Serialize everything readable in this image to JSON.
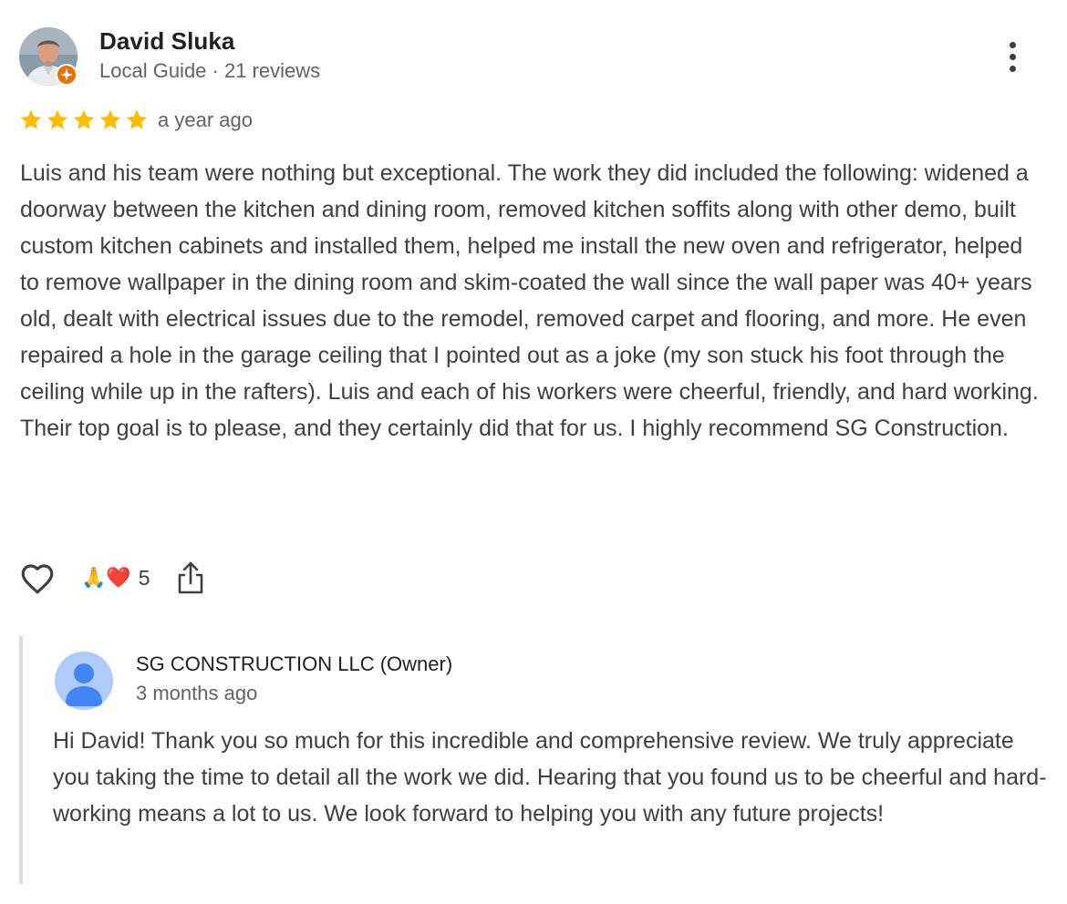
{
  "reviewer": {
    "name": "David Sluka",
    "meta": "Local Guide · 21 reviews",
    "avatar_icon": "reviewer-photo",
    "badge_icon": "local-guide-badge-icon"
  },
  "rating": {
    "stars": 5,
    "max_stars": 5,
    "star_color": "#fbbc04",
    "date": "a year ago"
  },
  "review_text": "Luis and his team were nothing but exceptional. The work they did included the following: widened a doorway between the kitchen and dining room, removed kitchen soffits along with other demo, built custom kitchen cabinets and installed them, helped me install the new oven and refrigerator, helped to remove wallpaper in the dining room and skim-coated the wall since the wall paper was 40+ years old, dealt with electrical issues due to the remodel, removed carpet and flooring, and more. He even repaired a hole in the garage ceiling that I pointed out as a joke (my son stuck his foot through the ceiling while up in the rafters). Luis and each of his workers were cheerful, friendly, and hard working. Their top goal is to please, and they certainly did that for us. I highly recommend SG Construction.",
  "actions": {
    "like_icon": "heart-outline-icon",
    "reactions_emoji": "🙏❤️",
    "reactions_count": "5",
    "share_icon": "share-icon"
  },
  "owner_reply": {
    "author": "SG CONSTRUCTION LLC (Owner)",
    "date": "3 months ago",
    "avatar_icon": "default-person-avatar-icon",
    "text": "Hi David! Thank you so much for this incredible and comprehensive review. We truly appreciate you taking the time to detail all the work we did. Hearing that you found us to be cheerful and hard-working means a lot to us. We look forward to helping you with any future projects!"
  },
  "colors": {
    "text": "#3c4043",
    "secondary": "#5f6368",
    "badge": "#e8710a",
    "reply_border": "#dadce0",
    "default_avatar_bg": "#aecbfa",
    "default_avatar_fg": "#4285f4"
  }
}
